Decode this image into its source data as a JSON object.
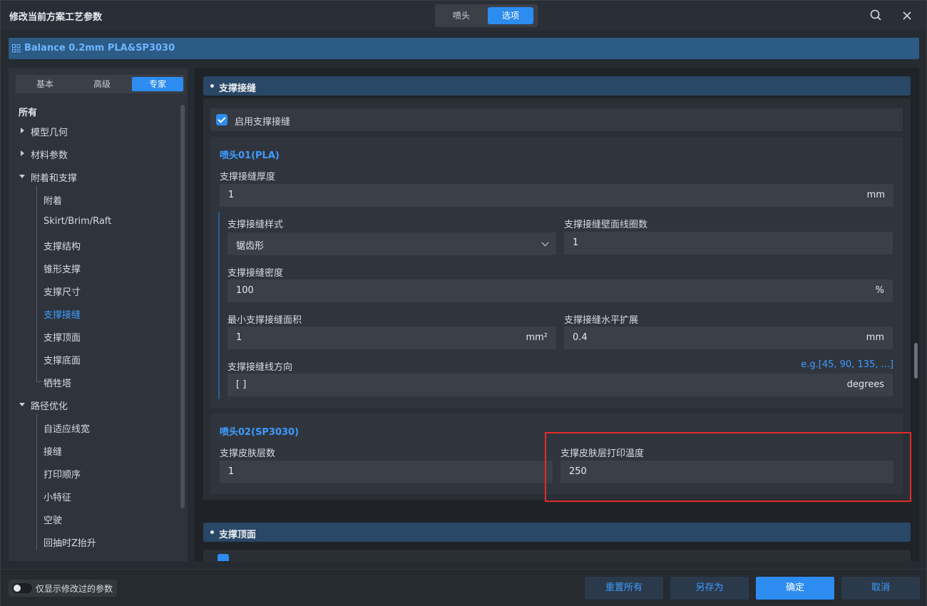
{
  "window": {
    "title": "修改当前方案工艺参数",
    "top_tabs": [
      "喷头",
      "选项"
    ],
    "active_top_tab": "选项"
  },
  "preset": {
    "name": "Balance 0.2mm PLA&SP3030"
  },
  "left": {
    "mode_tabs": [
      "基本",
      "高级",
      "专家"
    ],
    "active_mode": "专家",
    "tree_all": "所有",
    "tree": {
      "model_geometry": "模型几何",
      "material_params": "材料参数",
      "adhesion_support": "附着和支撑",
      "adhesion": "附着",
      "skirt": "Skirt/Brim/Raft",
      "support_structure": "支撑结构",
      "tree_support": "锥形支撑",
      "support_size": "支撑尺寸",
      "support_interface": "支撑接缝",
      "support_roof": "支撑顶面",
      "support_floor": "支撑底面",
      "prime_tower": "牺牲塔",
      "path_optimization": "路径优化",
      "adaptive_width": "自适应线宽",
      "seam": "接缝",
      "print_order": "打印顺序",
      "small_features": "小特征",
      "travel": "空驶",
      "z_hop": "回抽时Z抬升"
    }
  },
  "section1": {
    "title": "支撑接缝",
    "enable_label": "启用支撑接缝",
    "nozzle1": {
      "title": "喷头01(PLA)",
      "thickness_label": "支撑接缝厚度",
      "thickness_value": "1",
      "thickness_unit": "mm",
      "pattern_label": "支撑接缝样式",
      "pattern_value": "锯齿形",
      "wall_count_label": "支撑接缝壁面线圈数",
      "wall_count_value": "1",
      "density_label": "支撑接缝密度",
      "density_value": "100",
      "density_unit": "%",
      "min_area_label": "最小支撑接缝面积",
      "min_area_value": "1",
      "min_area_unit": "mm²",
      "h_expand_label": "支撑接缝水平扩展",
      "h_expand_value": "0.4",
      "h_expand_unit": "mm",
      "line_dir_label": "支撑接缝线方向",
      "line_dir_hint": "e.g.[45, 90, 135, ...]",
      "line_dir_value": "[ ]",
      "line_dir_unit": "degrees"
    },
    "nozzle2": {
      "title": "喷头02(SP3030)",
      "skin_layers_label": "支撑皮肤层数",
      "skin_layers_value": "1",
      "skin_temp_label": "支撑皮肤层打印温度",
      "skin_temp_value": "250"
    }
  },
  "section2": {
    "title": "支撑顶面"
  },
  "footer": {
    "toggle_label": "仅显示修改过的参数",
    "reset_all": "重置所有",
    "save_as": "另存为",
    "confirm": "确定",
    "cancel": "取消"
  },
  "colors": {
    "accent": "#2d8cf0",
    "link": "#3d9bff",
    "highlight": "#e22b2b"
  }
}
